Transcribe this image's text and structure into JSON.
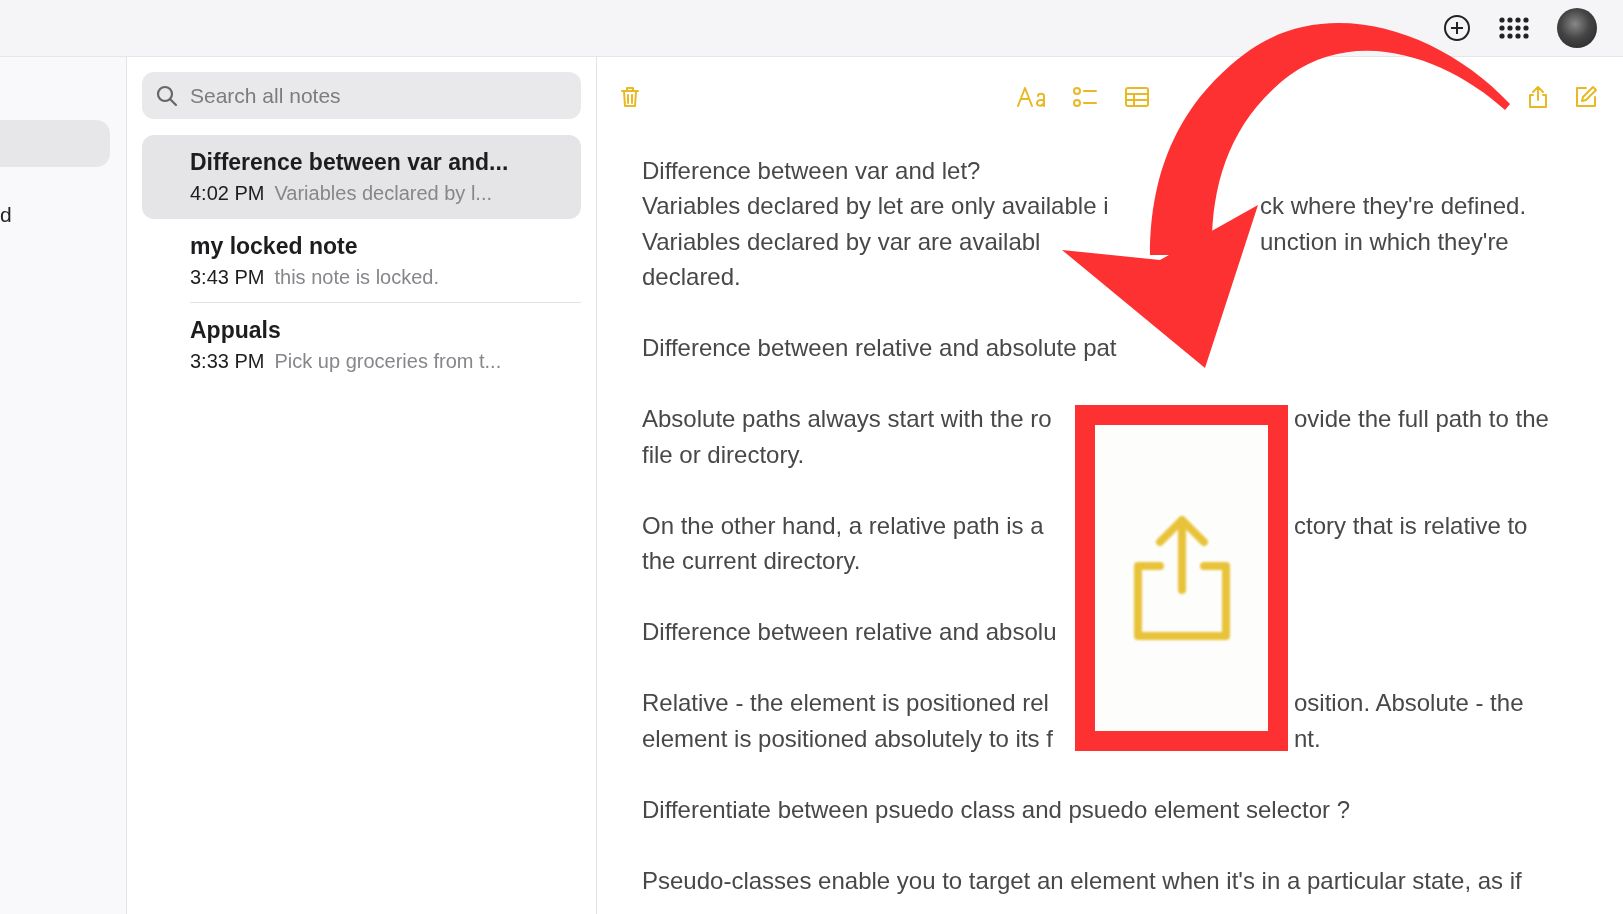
{
  "sidebar": {
    "items": [
      {
        "selected": true
      },
      {
        "label": "d",
        "selected": false
      }
    ]
  },
  "search": {
    "placeholder": "Search all notes"
  },
  "notes": [
    {
      "title": "Difference between var and...",
      "time": "4:02 PM",
      "preview": "Variables declared by l...",
      "selected": true
    },
    {
      "title": "my locked note",
      "time": "3:43 PM",
      "preview": "this note is locked.",
      "selected": false
    },
    {
      "title": "Appuals",
      "time": "3:33 PM",
      "preview": "Pick up groceries from t...",
      "selected": false
    }
  ],
  "note_body": {
    "paragraphs": [
      {
        "lines": [
          {
            "kind": "full",
            "text": "Difference between var and let?"
          },
          {
            "kind": "split-arrow",
            "left": "Variables declared by let are only available i",
            "right": "ck where they're defined."
          },
          {
            "kind": "split-arrow",
            "left": "Variables declared by var are availabl",
            "right": "unction in which they're"
          },
          {
            "kind": "full",
            "text": "declared."
          }
        ]
      },
      {
        "lines": [
          {
            "kind": "full",
            "text": "Difference between relative and absolute pat"
          }
        ]
      },
      {
        "lines": [
          {
            "kind": "split-box",
            "left": "Absolute paths always start with the ro",
            "right": "ovide the full path to the"
          },
          {
            "kind": "full",
            "text": "file or directory."
          }
        ]
      },
      {
        "lines": [
          {
            "kind": "split-box",
            "left": "On the other hand, a relative path is a",
            "right": "ctory that is relative to"
          },
          {
            "kind": "full",
            "text": "the current directory."
          }
        ]
      },
      {
        "lines": [
          {
            "kind": "full",
            "text": "Difference between relative and absolu"
          }
        ]
      },
      {
        "lines": [
          {
            "kind": "split-box",
            "left": "Relative - the element is positioned rel",
            "right": "osition. Absolute - the"
          },
          {
            "kind": "split-box",
            "left": "element is positioned absolutely to its f",
            "right": "nt."
          }
        ]
      },
      {
        "lines": [
          {
            "kind": "full",
            "text": "Differentiate between psuedo class and psuedo element selector ?"
          }
        ]
      },
      {
        "lines": [
          {
            "kind": "full",
            "text": "Pseudo-classes enable you to target an element when it's in a particular state, as if"
          }
        ]
      }
    ]
  }
}
